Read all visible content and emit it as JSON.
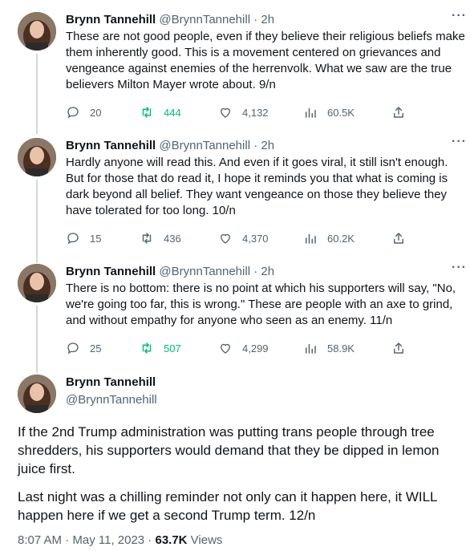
{
  "author": {
    "name": "Brynn Tannehill",
    "handle": "@BrynnTannehill"
  },
  "replies": [
    {
      "time": "2h",
      "header_handle_time": "@BrynnTannehill · 2h",
      "text": "These are not good people, even if they believe their religious beliefs make them inherently good. This is a movement centered on grievances and vengeance against enemies of the herrenvolk. What we saw are the true believers Milton Mayer wrote about. 9/n",
      "stats": {
        "replies": "20",
        "retweets": "444",
        "likes": "4,132",
        "views": "60.5K"
      },
      "retweeted": true
    },
    {
      "time": "2h",
      "header_handle_time": "@BrynnTannehill · 2h",
      "text": "Hardly anyone will read this. And even if it goes viral, it still isn't enough. But for those that do read it, I hope it reminds you that what is coming is dark beyond all belief. They want vengeance on those they believe they have tolerated for too long. 10/n",
      "stats": {
        "replies": "15",
        "retweets": "436",
        "likes": "4,370",
        "views": "60.2K"
      },
      "retweeted": false
    },
    {
      "time": "2h",
      "header_handle_time": "@BrynnTannehill · 2h",
      "text": "There is no bottom: there is no point at which his supporters will say, \"No, we're going too far, this is wrong.\" These are people with an axe to grind, and without empathy for anyone who seen as an enemy. 11/n",
      "stats": {
        "replies": "25",
        "retweets": "507",
        "likes": "4,299",
        "views": "58.9K"
      },
      "retweeted": true
    }
  ],
  "main_tweet": {
    "paragraph1": "If the 2nd Trump administration was putting trans people through tree shredders, his supporters would demand that they be dipped in lemon juice first.",
    "paragraph2": "Last night was a chilling reminder not only can it happen here, it WILL happen here if we get a second Trump term. 12/n",
    "timestamp": "8:07 AM · May 11, 2023 · ",
    "views_count": "63.7K",
    "views_label": " Views"
  },
  "more_glyph": "···",
  "colors": {
    "text": "#0f1419",
    "secondary": "#536471",
    "retweet_active": "#00ba7c",
    "thread_line": "#cfd9de"
  },
  "icons": [
    "reply-icon",
    "retweet-icon",
    "like-icon",
    "views-icon",
    "share-icon",
    "more-icon"
  ]
}
